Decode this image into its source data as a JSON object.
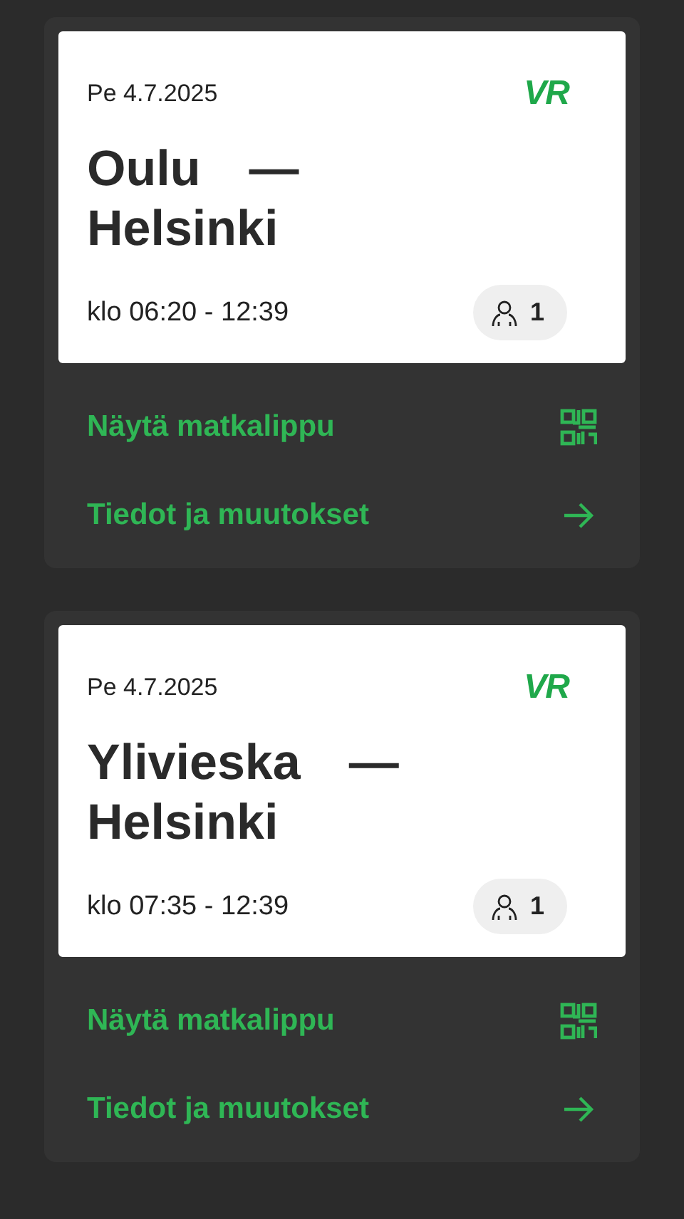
{
  "trips": [
    {
      "date": "Pe 4.7.2025",
      "logo": "VR",
      "origin": "Oulu",
      "separator": "—",
      "destination": "Helsinki",
      "time": "klo 06:20 - 12:39",
      "passengers": "1",
      "actions": [
        {
          "kind": "qr",
          "label": "Näytä matkalippu"
        },
        {
          "kind": "arrow",
          "label": "Tiedot ja muutokset"
        }
      ]
    },
    {
      "date": "Pe 4.7.2025",
      "logo": "VR",
      "origin": "Ylivieska",
      "separator": "—",
      "destination": "Helsinki",
      "time": "klo 07:35 - 12:39",
      "passengers": "1",
      "actions": [
        {
          "kind": "qr",
          "label": "Näytä matkalippu"
        },
        {
          "kind": "arrow",
          "label": "Tiedot ja muutokset"
        }
      ]
    }
  ]
}
